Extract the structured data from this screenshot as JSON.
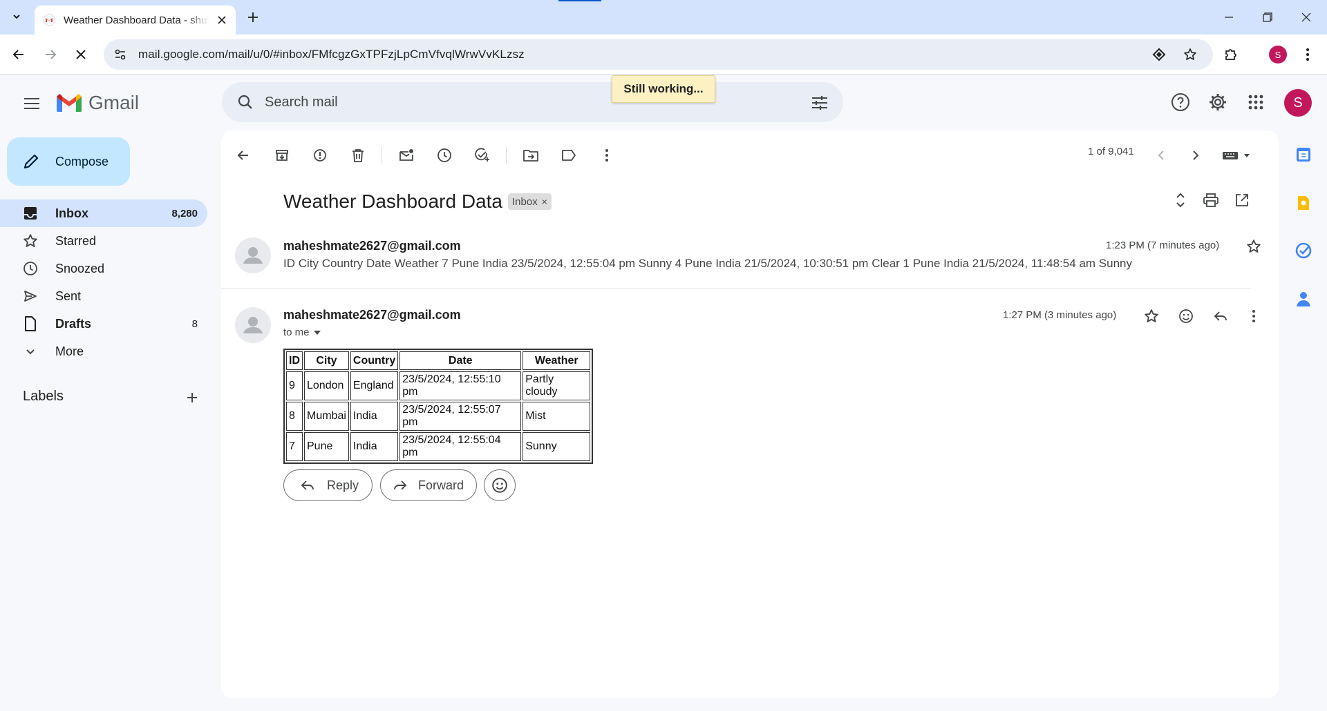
{
  "browser": {
    "tab_title": "Weather Dashboard Data - shul",
    "url": "mail.google.com/mail/u/0/#inbox/FMfcgzGxTPFzjLpCmVfvqlWrwVvKLzsz",
    "profile_initial": "S"
  },
  "gmail": {
    "product_name": "Gmail",
    "search_placeholder": "Search mail",
    "toast": "Still working...",
    "avatar_initial": "S",
    "compose_label": "Compose",
    "nav": [
      {
        "label": "Inbox",
        "count": "8,280",
        "icon": "inbox-icon"
      },
      {
        "label": "Starred",
        "count": "",
        "icon": "star-icon"
      },
      {
        "label": "Snoozed",
        "count": "",
        "icon": "clock-icon"
      },
      {
        "label": "Sent",
        "count": "",
        "icon": "send-icon"
      },
      {
        "label": "Drafts",
        "count": "8",
        "icon": "draft-icon"
      },
      {
        "label": "More",
        "count": "",
        "icon": "chevron-down-icon"
      }
    ],
    "labels_heading": "Labels"
  },
  "thread": {
    "pager": "1 of 9,041",
    "subject": "Weather Dashboard Data",
    "label_chip": "Inbox",
    "messages": [
      {
        "sender": "maheshmate2627@gmail.com",
        "time": "1:23 PM (7 minutes ago)",
        "snippet": "ID City Country Date Weather 7 Pune India 23/5/2024, 12:55:04 pm Sunny 4 Pune India 21/5/2024, 10:30:51 pm Clear 1 Pune India 21/5/2024, 11:48:54 am Sunny"
      },
      {
        "sender": "maheshmate2627@gmail.com",
        "time": "1:27 PM (3 minutes ago)",
        "to": "to me"
      }
    ],
    "table": {
      "headers": [
        "ID",
        "City",
        "Country",
        "Date",
        "Weather"
      ],
      "rows": [
        [
          "9",
          "London",
          "England",
          "23/5/2024, 12:55:10 pm",
          "Partly cloudy"
        ],
        [
          "8",
          "Mumbai",
          "India",
          "23/5/2024, 12:55:07 pm",
          "Mist"
        ],
        [
          "7",
          "Pune",
          "India",
          "23/5/2024, 12:55:04 pm",
          "Sunny"
        ]
      ]
    },
    "reply_label": "Reply",
    "forward_label": "Forward"
  },
  "colors": {
    "accent": "#0b57d0",
    "compose_bg": "#c2e7ff",
    "nav_active_bg": "#d3e3fd",
    "avatar": "#c2185b"
  }
}
